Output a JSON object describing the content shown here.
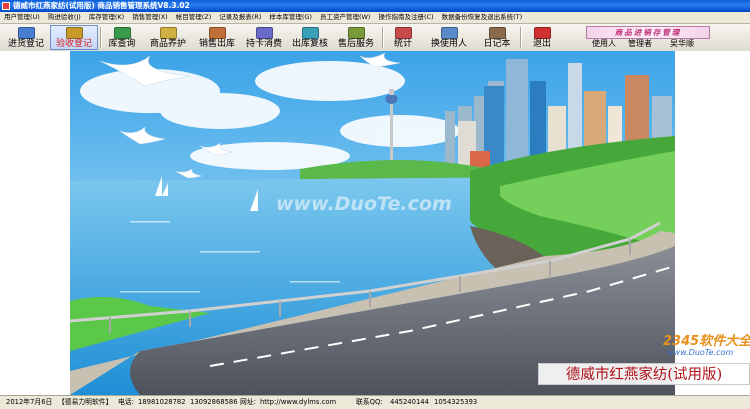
{
  "window": {
    "title": "德威市红燕家纺(试用版) 商品销售管理系统V8.3.02"
  },
  "menu": [
    "用户管理(U)",
    "购进验收(J)",
    "库存管理(K)",
    "销售管理(X)",
    "帐目管理(Z)",
    "记录及报表(R)",
    "样本库管理(G)",
    "员工资产管理(W)",
    "操作指南及注册(C)",
    "数据备份恢复及退出系统(T)"
  ],
  "toolbar": {
    "buttons": [
      {
        "label": "进货登记",
        "icon_color": "#4a7ed0"
      },
      {
        "label": "验收登记",
        "icon_color": "#c89a2a"
      },
      {
        "label": "库查询",
        "icon_color": "#3a9a4a"
      },
      {
        "label": "商品养护",
        "icon_color": "#d0b040"
      },
      {
        "label": "销售出库",
        "icon_color": "#c07038"
      },
      {
        "label": "持卡消费",
        "icon_color": "#6a6ac8"
      },
      {
        "label": "出库复核",
        "icon_color": "#3aa0b8"
      },
      {
        "label": "售后服务",
        "icon_color": "#7a9a3a"
      },
      {
        "label": "统计",
        "icon_color": "#c84a4a"
      },
      {
        "label": "换使用人",
        "icon_color": "#5a8ac8"
      },
      {
        "label": "日记本",
        "icon_color": "#8a6a4a"
      },
      {
        "label": "退出",
        "icon_color": "#d03030"
      }
    ],
    "brand_text": "商品进销存管理"
  },
  "user": {
    "label": "使用人",
    "role": "管理者",
    "name": "吴华顺"
  },
  "content": {
    "watermark": "www.DuoTe.com",
    "company_name": "德威市红燕家纺(试用版)",
    "logo_main": "2345软件大全",
    "logo_sub": "www.DuoTe.com"
  },
  "statusbar": {
    "date": "2012年7月6日",
    "vendor": "【德易力明软件】",
    "phone_label": "电话:",
    "phone1": "18981028782",
    "phone2": "13092868586",
    "site_label": "网址:",
    "site": "http://www.dylms.com",
    "qq_label": "联系QQ:",
    "qq1": "445240144",
    "qq2": "1054325393"
  }
}
